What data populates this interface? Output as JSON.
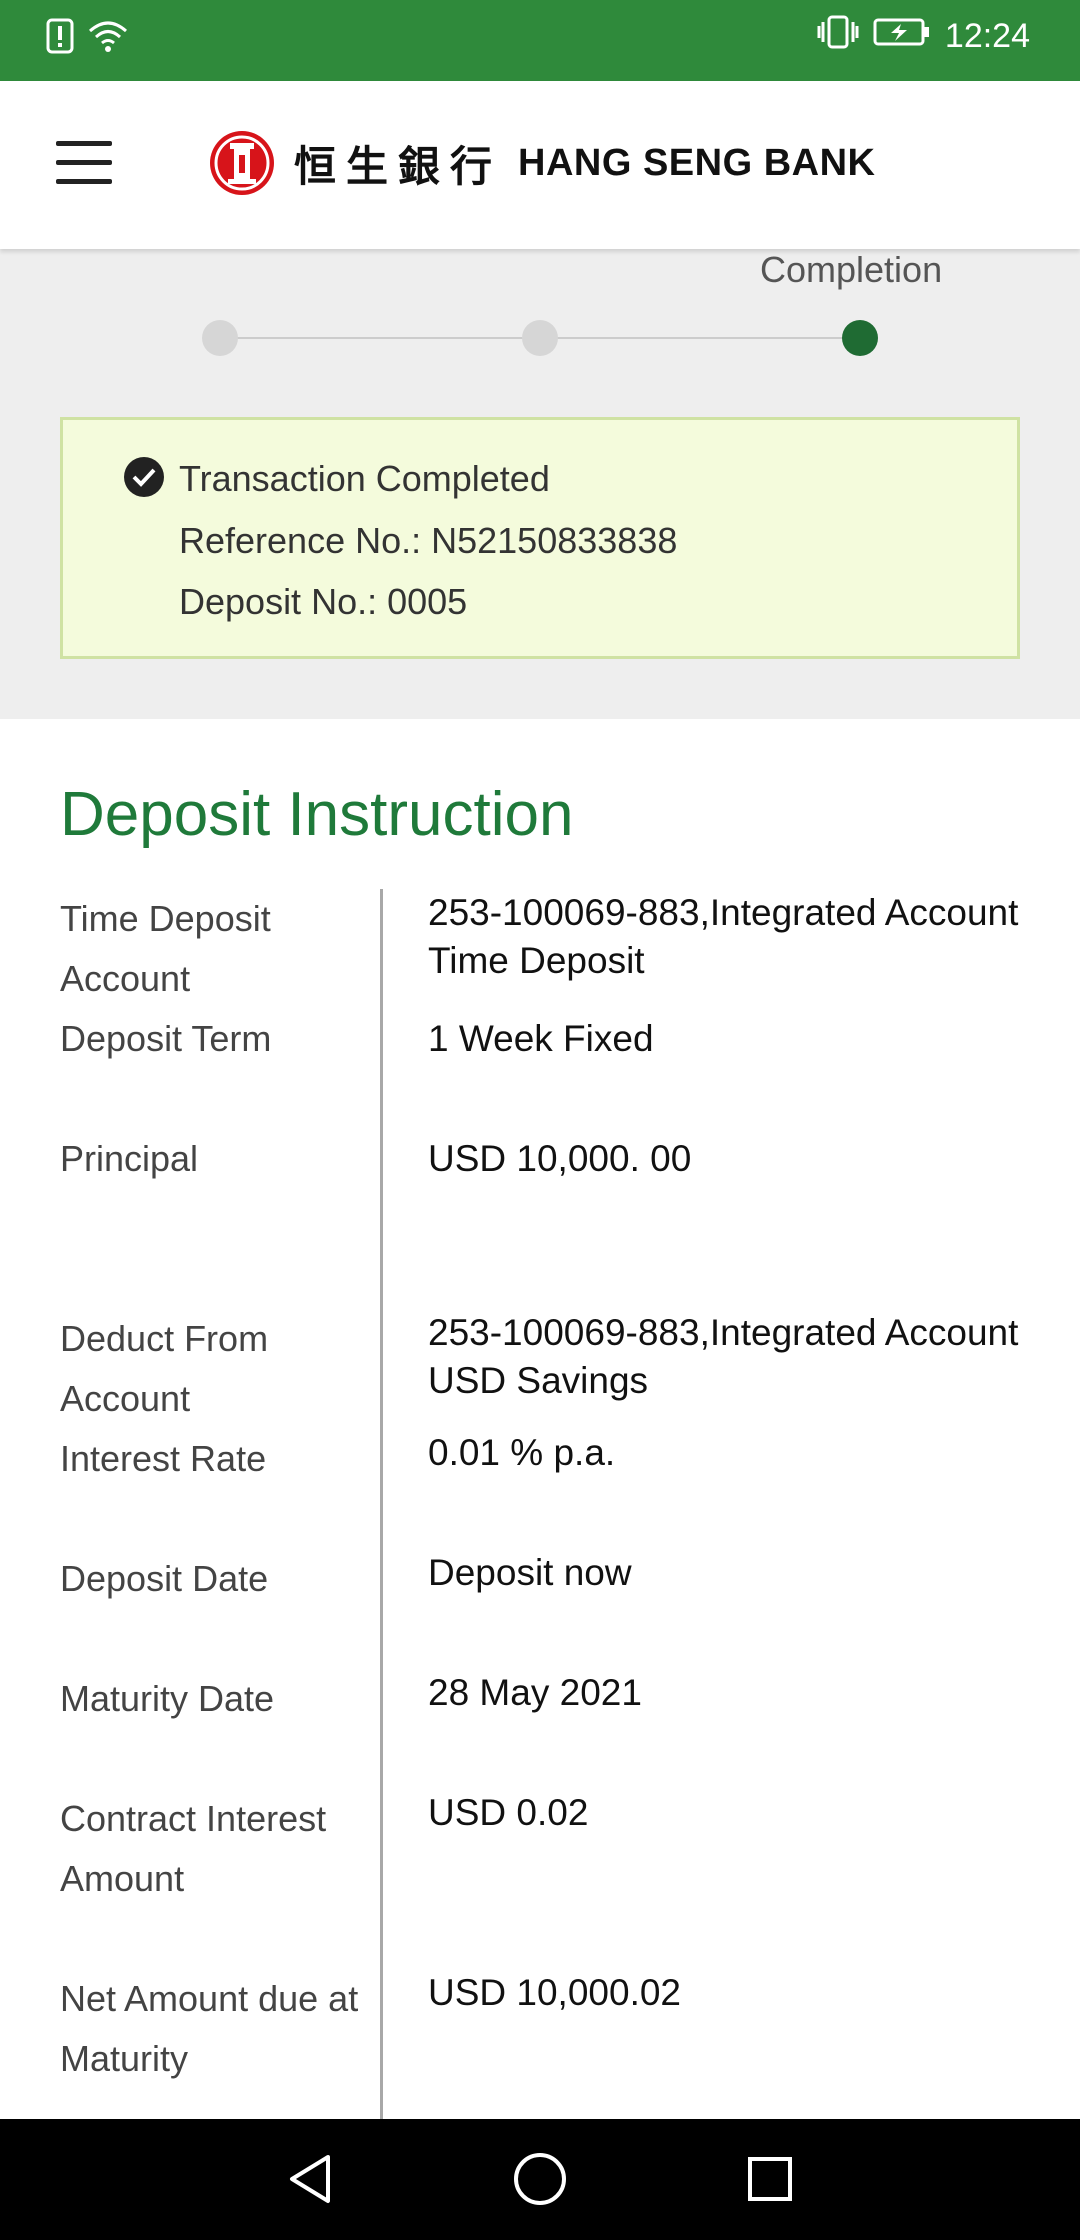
{
  "status_bar": {
    "time": "12:24",
    "icons": [
      "alert-icon",
      "wifi-icon",
      "vibrate-icon",
      "battery-charging-icon"
    ]
  },
  "header": {
    "logo_cn": "恒生銀行",
    "logo_en": "HANG SENG BANK",
    "brand_color": "#d7141a"
  },
  "progress": {
    "current_step_label": "Completion",
    "steps_total": 3,
    "active_step": 3
  },
  "confirmation": {
    "title": "Transaction Completed",
    "reference": "Reference No.: N52150833838",
    "deposit_no": "Deposit No.: 0005"
  },
  "deposit_instruction": {
    "title": "Deposit Instruction",
    "rows": [
      {
        "label": "Time Deposit Account",
        "value": "253-100069-883,Integrated Account Time Deposit"
      },
      {
        "label": "Deposit Term",
        "value": "1 Week Fixed"
      },
      {
        "label": "Principal",
        "value": "USD 10,000. 00"
      },
      {
        "label": "Deduct From Account",
        "value": "253-100069-883,Integrated Account USD Savings"
      },
      {
        "label": "Interest Rate",
        "value": "0.01 % p.a."
      },
      {
        "label": "Deposit Date",
        "value": "Deposit now"
      },
      {
        "label": "Maturity Date",
        "value": "28 May 2021"
      },
      {
        "label": "Contract Interest Amount",
        "value": "USD 0.02"
      },
      {
        "label": "Net Amount due at Maturity",
        "value": "USD 10,000.02"
      }
    ]
  },
  "colors": {
    "status_bar": "#2f8a3b",
    "accent_green": "#1f7a3a",
    "active_step": "#1f6b33",
    "success_bg": "#f4fbdc"
  }
}
